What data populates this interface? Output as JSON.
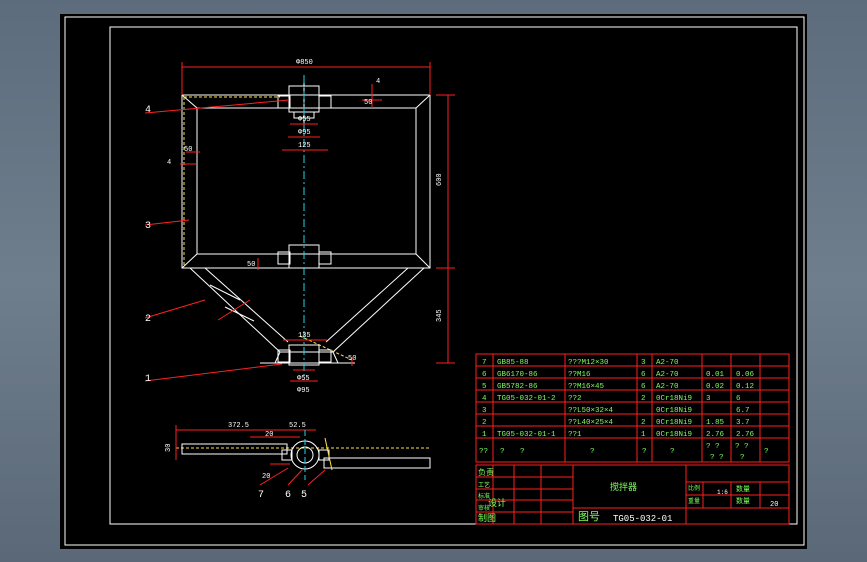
{
  "drawing": {
    "dimensions": {
      "top_width": "Φ850",
      "right_flange": "4",
      "flange_50": "50",
      "d55_top": "Φ55",
      "d95_top": "Φ95",
      "w125": "125",
      "left_4": "4",
      "left_50": "50",
      "h600": "600",
      "mid_50": "50",
      "h345": "345",
      "w135": "135",
      "d55_bot": "Φ55",
      "d95_bot": "Φ95",
      "bot_50": "50",
      "len372": "372.5",
      "d20a": "20",
      "d52": "52.5",
      "d30": "30",
      "d20b": "20"
    },
    "balloons": [
      "4",
      "3",
      "2",
      "1",
      "7",
      "6",
      "5"
    ]
  },
  "bom": {
    "rows": [
      {
        "no": "7",
        "code": "GB85-88",
        "name": "???M12×30",
        "qty": "3",
        "mat": "A2-70",
        "w1": "",
        "w2": ""
      },
      {
        "no": "6",
        "code": "GB6170-86",
        "name": "??M16",
        "qty": "6",
        "mat": "A2-70",
        "w1": "0.01",
        "w2": "0.06"
      },
      {
        "no": "5",
        "code": "GB5782-86",
        "name": "??M16×45",
        "qty": "6",
        "mat": "A2-70",
        "w1": "0.02",
        "w2": "0.12"
      },
      {
        "no": "4",
        "code": "TG05-032-01-2",
        "name": "??2",
        "qty": "2",
        "mat": "0Cr18Ni9",
        "w1": "3",
        "w2": "6"
      },
      {
        "no": "3",
        "code": "",
        "name": "??L50×32×4",
        "qty": "",
        "mat": "0Cr18Ni9",
        "w1": "",
        "w2": "6.7"
      },
      {
        "no": "2",
        "code": "",
        "name": "??L40×25×4",
        "qty": "2",
        "mat": "0Cr18Ni9",
        "w1": "1.85",
        "w2": "3.7"
      },
      {
        "no": "1",
        "code": "TG05-032-01-1",
        "name": "??1",
        "qty": "1",
        "mat": "0Cr18Ni9",
        "w1": "2.76",
        "w2": "2.76"
      }
    ],
    "header": {
      "a": "??",
      "b": "?",
      "c": "?",
      "d": "?",
      "e": "?",
      "f": "? ?",
      "g": "? ?",
      "h": "?",
      "i": "?",
      "j": "? ?",
      "k": "?"
    }
  },
  "title_block": {
    "labels": [
      "负责",
      "工艺",
      "标准",
      "审核",
      "设计",
      "制图"
    ],
    "title": "搅拌器",
    "scale_label": "比例",
    "weight_label": "重量",
    "scale": "1:6",
    "qty_label": "数量",
    "qty_label2": "数量",
    "qty": "20",
    "drawing_no_label": "图号",
    "drawing_no": "TG05-032-01"
  }
}
